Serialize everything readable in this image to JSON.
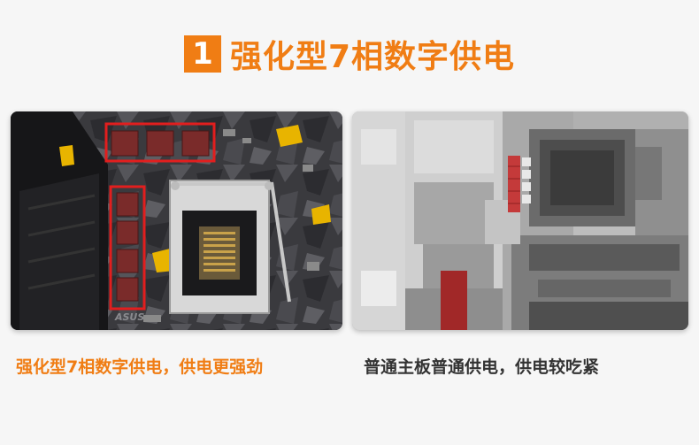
{
  "header": {
    "badge_number": "1",
    "title": "强化型7相数字供电"
  },
  "left_panel": {
    "brand_logo": "ASUS"
  },
  "captions": {
    "left": "强化型7相数字供电，供电更强劲",
    "right": "普通主板普通供电，供电较吃紧"
  },
  "colors": {
    "accent": "#f07d14",
    "highlight_box": "#e21e1e",
    "caption_dark": "#333333"
  }
}
